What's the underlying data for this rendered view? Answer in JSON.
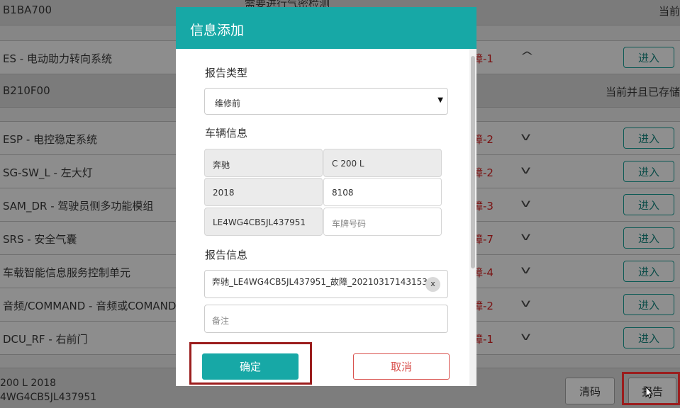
{
  "background": {
    "top_row": {
      "code": "B1BA700",
      "desc_partial": "需要进行气密检测",
      "status_partial": "当前"
    },
    "rows": [
      {
        "name": "ES - 电动助力转向系统",
        "fault": "障-1",
        "chev": "^",
        "button": "进入"
      },
      {
        "name": "ESP - 电控稳定系统",
        "fault": "障-2",
        "chev": "v",
        "button": "进入"
      },
      {
        "name": "SG-SW_L - 左大灯",
        "fault": "障-2",
        "chev": "v",
        "button": "进入"
      },
      {
        "name": "SAM_DR - 驾驶员侧多功能模组",
        "fault": "障-3",
        "chev": "v",
        "button": "进入"
      },
      {
        "name": "SRS - 安全气囊",
        "fault": "障-7",
        "chev": "v",
        "button": "进入"
      },
      {
        "name": "车载智能信息服务控制单元",
        "fault": "障-4",
        "chev": "v",
        "button": "进入"
      },
      {
        "name": "音频/COMMAND - 音频或COMAND(",
        "fault": "障-2",
        "chev": "v",
        "button": "进入"
      },
      {
        "name": "DCU_RF - 右前门",
        "fault": "障-1",
        "chev": "v",
        "button": "进入"
      }
    ],
    "code_row": {
      "code": "B210F00",
      "status": "当前并且已存储"
    },
    "footer": {
      "line1": " 200 L 2018",
      "line2": "4WG4CB5JL437951",
      "clear_button": "清码",
      "report_button": "报告"
    }
  },
  "modal": {
    "title": "信息添加",
    "report_type_label": "报告类型",
    "report_type_value": "维修前",
    "vehicle_info_label": "车辆信息",
    "vehicle": {
      "brand": "奔驰",
      "model": "C 200 L",
      "year": "2018",
      "mileage": "8108",
      "vin": "LE4WG4CB5JL437951",
      "plate_placeholder": "车牌号码"
    },
    "report_info_label": "报告信息",
    "report_name": "奔驰_LE4WG4CB5JL437951_故障_20210317143153",
    "clear_x": "x",
    "note_placeholder": "备注",
    "confirm_button": "确定",
    "cancel_button": "取消"
  }
}
